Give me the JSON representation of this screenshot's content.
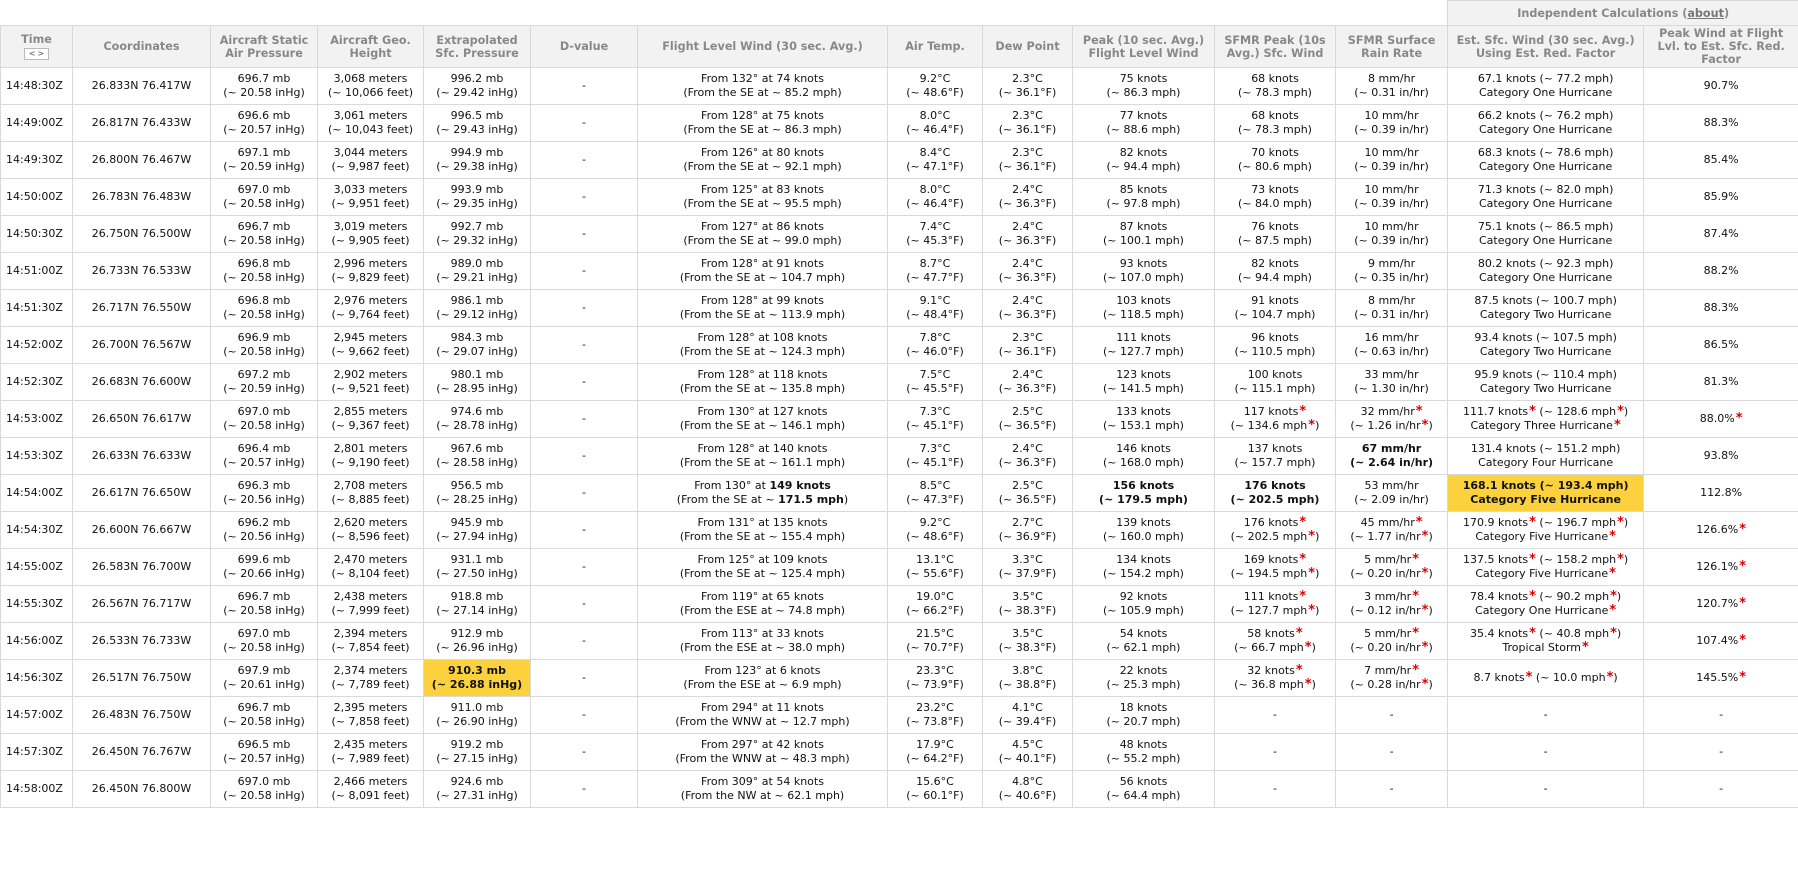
{
  "group_header": {
    "label": "Independent Calculations",
    "link": "about"
  },
  "sort_controls": {
    "prev": "<",
    "next": ">"
  },
  "colors": {
    "highlight": "#fbd23d",
    "flag": "#dd0000",
    "header_bg": "#f2f2f2",
    "header_text": "#888888",
    "border": "#d9d9d9"
  },
  "icons": {
    "flag": "asterisk"
  },
  "columns": [
    "Time",
    "Coordinates",
    "Aircraft Static Air Pressure",
    "Aircraft Geo. Height",
    "Extrapolated Sfc. Pressure",
    "D-value",
    "Flight Level Wind (30 sec. Avg.)",
    "Air Temp.",
    "Dew Point",
    "Peak (10 sec. Avg.) Flight Level Wind",
    "SFMR Peak (10s Avg.) Sfc. Wind",
    "SFMR Surface Rain Rate",
    "Est. Sfc. Wind (30 sec. Avg.) Using Est. Red. Factor",
    "Peak Wind at Flight Lvl. to Est. Sfc. Red. Factor"
  ],
  "rows": [
    {
      "time": "14:48:30Z",
      "coords": "26.833N 76.417W",
      "pressure": [
        "696.7 mb",
        "(~ 20.58 inHg)"
      ],
      "height": [
        "3,068 meters",
        "(~ 10,066 feet)"
      ],
      "sfc_pressure": [
        "996.2 mb",
        "(~ 29.42 inHg)"
      ],
      "dvalue": "-",
      "wind": [
        "From 132° at 74 knots",
        "(From the SE at ~ 85.2 mph)"
      ],
      "air_temp": [
        "9.2°C",
        "(~ 48.6°F)"
      ],
      "dew_point": [
        "2.3°C",
        "(~ 36.1°F)"
      ],
      "peak_fl": [
        "75 knots",
        "(~ 86.3 mph)"
      ],
      "sfmr_wind": [
        "68 knots",
        "(~ 78.3 mph)"
      ],
      "rain": [
        "8 mm/hr",
        "(~ 0.31 in/hr)"
      ],
      "est_wind": [
        "67.1 knots (~ 77.2 mph)",
        "Category One Hurricane"
      ],
      "factor": "90.7%"
    },
    {
      "time": "14:49:00Z",
      "coords": "26.817N 76.433W",
      "pressure": [
        "696.6 mb",
        "(~ 20.57 inHg)"
      ],
      "height": [
        "3,061 meters",
        "(~ 10,043 feet)"
      ],
      "sfc_pressure": [
        "996.5 mb",
        "(~ 29.43 inHg)"
      ],
      "dvalue": "-",
      "wind": [
        "From 128° at 75 knots",
        "(From the SE at ~ 86.3 mph)"
      ],
      "air_temp": [
        "8.0°C",
        "(~ 46.4°F)"
      ],
      "dew_point": [
        "2.3°C",
        "(~ 36.1°F)"
      ],
      "peak_fl": [
        "77 knots",
        "(~ 88.6 mph)"
      ],
      "sfmr_wind": [
        "68 knots",
        "(~ 78.3 mph)"
      ],
      "rain": [
        "10 mm/hr",
        "(~ 0.39 in/hr)"
      ],
      "est_wind": [
        "66.2 knots (~ 76.2 mph)",
        "Category One Hurricane"
      ],
      "factor": "88.3%"
    },
    {
      "time": "14:49:30Z",
      "coords": "26.800N 76.467W",
      "pressure": [
        "697.1 mb",
        "(~ 20.59 inHg)"
      ],
      "height": [
        "3,044 meters",
        "(~ 9,987 feet)"
      ],
      "sfc_pressure": [
        "994.9 mb",
        "(~ 29.38 inHg)"
      ],
      "dvalue": "-",
      "wind": [
        "From 126° at 80 knots",
        "(From the SE at ~ 92.1 mph)"
      ],
      "air_temp": [
        "8.4°C",
        "(~ 47.1°F)"
      ],
      "dew_point": [
        "2.3°C",
        "(~ 36.1°F)"
      ],
      "peak_fl": [
        "82 knots",
        "(~ 94.4 mph)"
      ],
      "sfmr_wind": [
        "70 knots",
        "(~ 80.6 mph)"
      ],
      "rain": [
        "10 mm/hr",
        "(~ 0.39 in/hr)"
      ],
      "est_wind": [
        "68.3 knots (~ 78.6 mph)",
        "Category One Hurricane"
      ],
      "factor": "85.4%"
    },
    {
      "time": "14:50:00Z",
      "coords": "26.783N 76.483W",
      "pressure": [
        "697.0 mb",
        "(~ 20.58 inHg)"
      ],
      "height": [
        "3,033 meters",
        "(~ 9,951 feet)"
      ],
      "sfc_pressure": [
        "993.9 mb",
        "(~ 29.35 inHg)"
      ],
      "dvalue": "-",
      "wind": [
        "From 125° at 83 knots",
        "(From the SE at ~ 95.5 mph)"
      ],
      "air_temp": [
        "8.0°C",
        "(~ 46.4°F)"
      ],
      "dew_point": [
        "2.4°C",
        "(~ 36.3°F)"
      ],
      "peak_fl": [
        "85 knots",
        "(~ 97.8 mph)"
      ],
      "sfmr_wind": [
        "73 knots",
        "(~ 84.0 mph)"
      ],
      "rain": [
        "10 mm/hr",
        "(~ 0.39 in/hr)"
      ],
      "est_wind": [
        "71.3 knots (~ 82.0 mph)",
        "Category One Hurricane"
      ],
      "factor": "85.9%"
    },
    {
      "time": "14:50:30Z",
      "coords": "26.750N 76.500W",
      "pressure": [
        "696.7 mb",
        "(~ 20.58 inHg)"
      ],
      "height": [
        "3,019 meters",
        "(~ 9,905 feet)"
      ],
      "sfc_pressure": [
        "992.7 mb",
        "(~ 29.32 inHg)"
      ],
      "dvalue": "-",
      "wind": [
        "From 127° at 86 knots",
        "(From the SE at ~ 99.0 mph)"
      ],
      "air_temp": [
        "7.4°C",
        "(~ 45.3°F)"
      ],
      "dew_point": [
        "2.4°C",
        "(~ 36.3°F)"
      ],
      "peak_fl": [
        "87 knots",
        "(~ 100.1 mph)"
      ],
      "sfmr_wind": [
        "76 knots",
        "(~ 87.5 mph)"
      ],
      "rain": [
        "10 mm/hr",
        "(~ 0.39 in/hr)"
      ],
      "est_wind": [
        "75.1 knots (~ 86.5 mph)",
        "Category One Hurricane"
      ],
      "factor": "87.4%"
    },
    {
      "time": "14:51:00Z",
      "coords": "26.733N 76.533W",
      "pressure": [
        "696.8 mb",
        "(~ 20.58 inHg)"
      ],
      "height": [
        "2,996 meters",
        "(~ 9,829 feet)"
      ],
      "sfc_pressure": [
        "989.0 mb",
        "(~ 29.21 inHg)"
      ],
      "dvalue": "-",
      "wind": [
        "From 128° at 91 knots",
        "(From the SE at ~ 104.7 mph)"
      ],
      "air_temp": [
        "8.7°C",
        "(~ 47.7°F)"
      ],
      "dew_point": [
        "2.4°C",
        "(~ 36.3°F)"
      ],
      "peak_fl": [
        "93 knots",
        "(~ 107.0 mph)"
      ],
      "sfmr_wind": [
        "82 knots",
        "(~ 94.4 mph)"
      ],
      "rain": [
        "9 mm/hr",
        "(~ 0.35 in/hr)"
      ],
      "est_wind": [
        "80.2 knots (~ 92.3 mph)",
        "Category One Hurricane"
      ],
      "factor": "88.2%"
    },
    {
      "time": "14:51:30Z",
      "coords": "26.717N 76.550W",
      "pressure": [
        "696.8 mb",
        "(~ 20.58 inHg)"
      ],
      "height": [
        "2,976 meters",
        "(~ 9,764 feet)"
      ],
      "sfc_pressure": [
        "986.1 mb",
        "(~ 29.12 inHg)"
      ],
      "dvalue": "-",
      "wind": [
        "From 128° at 99 knots",
        "(From the SE at ~ 113.9 mph)"
      ],
      "air_temp": [
        "9.1°C",
        "(~ 48.4°F)"
      ],
      "dew_point": [
        "2.4°C",
        "(~ 36.3°F)"
      ],
      "peak_fl": [
        "103 knots",
        "(~ 118.5 mph)"
      ],
      "sfmr_wind": [
        "91 knots",
        "(~ 104.7 mph)"
      ],
      "rain": [
        "8 mm/hr",
        "(~ 0.31 in/hr)"
      ],
      "est_wind": [
        "87.5 knots (~ 100.7 mph)",
        "Category Two Hurricane"
      ],
      "factor": "88.3%"
    },
    {
      "time": "14:52:00Z",
      "coords": "26.700N 76.567W",
      "pressure": [
        "696.9 mb",
        "(~ 20.58 inHg)"
      ],
      "height": [
        "2,945 meters",
        "(~ 9,662 feet)"
      ],
      "sfc_pressure": [
        "984.3 mb",
        "(~ 29.07 inHg)"
      ],
      "dvalue": "-",
      "wind": [
        "From 128° at 108 knots",
        "(From the SE at ~ 124.3 mph)"
      ],
      "air_temp": [
        "7.8°C",
        "(~ 46.0°F)"
      ],
      "dew_point": [
        "2.3°C",
        "(~ 36.1°F)"
      ],
      "peak_fl": [
        "111 knots",
        "(~ 127.7 mph)"
      ],
      "sfmr_wind": [
        "96 knots",
        "(~ 110.5 mph)"
      ],
      "rain": [
        "16 mm/hr",
        "(~ 0.63 in/hr)"
      ],
      "est_wind": [
        "93.4 knots (~ 107.5 mph)",
        "Category Two Hurricane"
      ],
      "factor": "86.5%"
    },
    {
      "time": "14:52:30Z",
      "coords": "26.683N 76.600W",
      "pressure": [
        "697.2 mb",
        "(~ 20.59 inHg)"
      ],
      "height": [
        "2,902 meters",
        "(~ 9,521 feet)"
      ],
      "sfc_pressure": [
        "980.1 mb",
        "(~ 28.95 inHg)"
      ],
      "dvalue": "-",
      "wind": [
        "From 128° at 118 knots",
        "(From the SE at ~ 135.8 mph)"
      ],
      "air_temp": [
        "7.5°C",
        "(~ 45.5°F)"
      ],
      "dew_point": [
        "2.4°C",
        "(~ 36.3°F)"
      ],
      "peak_fl": [
        "123 knots",
        "(~ 141.5 mph)"
      ],
      "sfmr_wind": [
        "100 knots",
        "(~ 115.1 mph)"
      ],
      "rain": [
        "33 mm/hr",
        "(~ 1.30 in/hr)"
      ],
      "est_wind": [
        "95.9 knots (~ 110.4 mph)",
        "Category Two Hurricane"
      ],
      "factor": "81.3%"
    },
    {
      "time": "14:53:00Z",
      "coords": "26.650N 76.617W",
      "pressure": [
        "697.0 mb",
        "(~ 20.58 inHg)"
      ],
      "height": [
        "2,855 meters",
        "(~ 9,367 feet)"
      ],
      "sfc_pressure": [
        "974.6 mb",
        "(~ 28.78 inHg)"
      ],
      "dvalue": "-",
      "wind": [
        "From 130° at 127 knots",
        "(From the SE at ~ 146.1 mph)"
      ],
      "air_temp": [
        "7.3°C",
        "(~ 45.1°F)"
      ],
      "dew_point": [
        "2.5°C",
        "(~ 36.5°F)"
      ],
      "peak_fl": [
        "133 knots",
        "(~ 153.1 mph)"
      ],
      "sfmr_wind": [
        "117 knots*",
        "(~ 134.6 mph*)"
      ],
      "rain": [
        "32 mm/hr*",
        "(~ 1.26 in/hr*)"
      ],
      "est_wind": [
        "111.7 knots* (~ 128.6 mph*)",
        "Category Three Hurricane*"
      ],
      "factor": "88.0%*"
    },
    {
      "time": "14:53:30Z",
      "coords": "26.633N 76.633W",
      "pressure": [
        "696.4 mb",
        "(~ 20.57 inHg)"
      ],
      "height": [
        "2,801 meters",
        "(~ 9,190 feet)"
      ],
      "sfc_pressure": [
        "967.6 mb",
        "(~ 28.58 inHg)"
      ],
      "dvalue": "-",
      "wind": [
        "From 128° at 140 knots",
        "(From the SE at ~ 161.1 mph)"
      ],
      "air_temp": [
        "7.3°C",
        "(~ 45.1°F)"
      ],
      "dew_point": [
        "2.4°C",
        "(~ 36.3°F)"
      ],
      "peak_fl": [
        "146 knots",
        "(~ 168.0 mph)"
      ],
      "sfmr_wind": [
        "137 knots",
        "(~ 157.7 mph)"
      ],
      "rain": [
        "**67 mm/hr**",
        "**(~ 2.64 in/hr)**"
      ],
      "est_wind": [
        "131.4 knots (~ 151.2 mph)",
        "Category Four Hurricane"
      ],
      "factor": "93.8%"
    },
    {
      "time": "14:54:00Z",
      "coords": "26.617N 76.650W",
      "pressure": [
        "696.3 mb",
        "(~ 20.56 inHg)"
      ],
      "height": [
        "2,708 meters",
        "(~ 8,885 feet)"
      ],
      "sfc_pressure": [
        "956.5 mb",
        "(~ 28.25 inHg)"
      ],
      "dvalue": "-",
      "wind": [
        "From 130° at **149 knots**",
        "(From the SE at ~ **171.5 mph**)"
      ],
      "air_temp": [
        "8.5°C",
        "(~ 47.3°F)"
      ],
      "dew_point": [
        "2.5°C",
        "(~ 36.5°F)"
      ],
      "peak_fl": [
        "**156 knots**",
        "**(~ 179.5 mph)**"
      ],
      "sfmr_wind": [
        "**176 knots**",
        "**(~ 202.5 mph)**"
      ],
      "rain": [
        "53 mm/hr",
        "(~ 2.09 in/hr)"
      ],
      "est_wind": [
        "**168.1 knots (~ 193.4 mph)**",
        "**Category Five Hurricane**"
      ],
      "factor": "112.8%",
      "highlight": "est_wind"
    },
    {
      "time": "14:54:30Z",
      "coords": "26.600N 76.667W",
      "pressure": [
        "696.2 mb",
        "(~ 20.56 inHg)"
      ],
      "height": [
        "2,620 meters",
        "(~ 8,596 feet)"
      ],
      "sfc_pressure": [
        "945.9 mb",
        "(~ 27.94 inHg)"
      ],
      "dvalue": "-",
      "wind": [
        "From 131° at 135 knots",
        "(From the SE at ~ 155.4 mph)"
      ],
      "air_temp": [
        "9.2°C",
        "(~ 48.6°F)"
      ],
      "dew_point": [
        "2.7°C",
        "(~ 36.9°F)"
      ],
      "peak_fl": [
        "139 knots",
        "(~ 160.0 mph)"
      ],
      "sfmr_wind": [
        "176 knots*",
        "(~ 202.5 mph*)"
      ],
      "rain": [
        "45 mm/hr*",
        "(~ 1.77 in/hr*)"
      ],
      "est_wind": [
        "170.9 knots* (~ 196.7 mph*)",
        "Category Five Hurricane*"
      ],
      "factor": "126.6%*"
    },
    {
      "time": "14:55:00Z",
      "coords": "26.583N 76.700W",
      "pressure": [
        "699.6 mb",
        "(~ 20.66 inHg)"
      ],
      "height": [
        "2,470 meters",
        "(~ 8,104 feet)"
      ],
      "sfc_pressure": [
        "931.1 mb",
        "(~ 27.50 inHg)"
      ],
      "dvalue": "-",
      "wind": [
        "From 125° at 109 knots",
        "(From the SE at ~ 125.4 mph)"
      ],
      "air_temp": [
        "13.1°C",
        "(~ 55.6°F)"
      ],
      "dew_point": [
        "3.3°C",
        "(~ 37.9°F)"
      ],
      "peak_fl": [
        "134 knots",
        "(~ 154.2 mph)"
      ],
      "sfmr_wind": [
        "169 knots*",
        "(~ 194.5 mph*)"
      ],
      "rain": [
        "5 mm/hr*",
        "(~ 0.20 in/hr*)"
      ],
      "est_wind": [
        "137.5 knots* (~ 158.2 mph*)",
        "Category Five Hurricane*"
      ],
      "factor": "126.1%*"
    },
    {
      "time": "14:55:30Z",
      "coords": "26.567N 76.717W",
      "pressure": [
        "696.7 mb",
        "(~ 20.58 inHg)"
      ],
      "height": [
        "2,438 meters",
        "(~ 7,999 feet)"
      ],
      "sfc_pressure": [
        "918.8 mb",
        "(~ 27.14 inHg)"
      ],
      "dvalue": "-",
      "wind": [
        "From 119° at 65 knots",
        "(From the ESE at ~ 74.8 mph)"
      ],
      "air_temp": [
        "19.0°C",
        "(~ 66.2°F)"
      ],
      "dew_point": [
        "3.5°C",
        "(~ 38.3°F)"
      ],
      "peak_fl": [
        "92 knots",
        "(~ 105.9 mph)"
      ],
      "sfmr_wind": [
        "111 knots*",
        "(~ 127.7 mph*)"
      ],
      "rain": [
        "3 mm/hr*",
        "(~ 0.12 in/hr*)"
      ],
      "est_wind": [
        "78.4 knots* (~ 90.2 mph*)",
        "Category One Hurricane*"
      ],
      "factor": "120.7%*"
    },
    {
      "time": "14:56:00Z",
      "coords": "26.533N 76.733W",
      "pressure": [
        "697.0 mb",
        "(~ 20.58 inHg)"
      ],
      "height": [
        "2,394 meters",
        "(~ 7,854 feet)"
      ],
      "sfc_pressure": [
        "912.9 mb",
        "(~ 26.96 inHg)"
      ],
      "dvalue": "-",
      "wind": [
        "From 113° at 33 knots",
        "(From the ESE at ~ 38.0 mph)"
      ],
      "air_temp": [
        "21.5°C",
        "(~ 70.7°F)"
      ],
      "dew_point": [
        "3.5°C",
        "(~ 38.3°F)"
      ],
      "peak_fl": [
        "54 knots",
        "(~ 62.1 mph)"
      ],
      "sfmr_wind": [
        "58 knots*",
        "(~ 66.7 mph*)"
      ],
      "rain": [
        "5 mm/hr*",
        "(~ 0.20 in/hr*)"
      ],
      "est_wind": [
        "35.4 knots* (~ 40.8 mph*)",
        "Tropical Storm*"
      ],
      "factor": "107.4%*"
    },
    {
      "time": "14:56:30Z",
      "coords": "26.517N 76.750W",
      "pressure": [
        "697.9 mb",
        "(~ 20.61 inHg)"
      ],
      "height": [
        "2,374 meters",
        "(~ 7,789 feet)"
      ],
      "sfc_pressure": [
        "**910.3 mb**",
        "**(~ 26.88 inHg)**"
      ],
      "dvalue": "-",
      "wind": [
        "From 123° at 6 knots",
        "(From the ESE at ~ 6.9 mph)"
      ],
      "air_temp": [
        "23.3°C",
        "(~ 73.9°F)"
      ],
      "dew_point": [
        "3.8°C",
        "(~ 38.8°F)"
      ],
      "peak_fl": [
        "22 knots",
        "(~ 25.3 mph)"
      ],
      "sfmr_wind": [
        "32 knots*",
        "(~ 36.8 mph*)"
      ],
      "rain": [
        "7 mm/hr*",
        "(~ 0.28 in/hr*)"
      ],
      "est_wind": [
        "8.7 knots* (~ 10.0 mph*)"
      ],
      "factor": "145.5%*",
      "highlight": "sfc_pressure"
    },
    {
      "time": "14:57:00Z",
      "coords": "26.483N 76.750W",
      "pressure": [
        "696.7 mb",
        "(~ 20.58 inHg)"
      ],
      "height": [
        "2,395 meters",
        "(~ 7,858 feet)"
      ],
      "sfc_pressure": [
        "911.0 mb",
        "(~ 26.90 inHg)"
      ],
      "dvalue": "-",
      "wind": [
        "From 294° at 11 knots",
        "(From the WNW at ~ 12.7 mph)"
      ],
      "air_temp": [
        "23.2°C",
        "(~ 73.8°F)"
      ],
      "dew_point": [
        "4.1°C",
        "(~ 39.4°F)"
      ],
      "peak_fl": [
        "18 knots",
        "(~ 20.7 mph)"
      ],
      "sfmr_wind": [
        "-"
      ],
      "rain": [
        "-"
      ],
      "est_wind": [
        "-"
      ],
      "factor": "-"
    },
    {
      "time": "14:57:30Z",
      "coords": "26.450N 76.767W",
      "pressure": [
        "696.5 mb",
        "(~ 20.57 inHg)"
      ],
      "height": [
        "2,435 meters",
        "(~ 7,989 feet)"
      ],
      "sfc_pressure": [
        "919.2 mb",
        "(~ 27.15 inHg)"
      ],
      "dvalue": "-",
      "wind": [
        "From 297° at 42 knots",
        "(From the WNW at ~ 48.3 mph)"
      ],
      "air_temp": [
        "17.9°C",
        "(~ 64.2°F)"
      ],
      "dew_point": [
        "4.5°C",
        "(~ 40.1°F)"
      ],
      "peak_fl": [
        "48 knots",
        "(~ 55.2 mph)"
      ],
      "sfmr_wind": [
        "-"
      ],
      "rain": [
        "-"
      ],
      "est_wind": [
        "-"
      ],
      "factor": "-"
    },
    {
      "time": "14:58:00Z",
      "coords": "26.450N 76.800W",
      "pressure": [
        "697.0 mb",
        "(~ 20.58 inHg)"
      ],
      "height": [
        "2,466 meters",
        "(~ 8,091 feet)"
      ],
      "sfc_pressure": [
        "924.6 mb",
        "(~ 27.31 inHg)"
      ],
      "dvalue": "-",
      "wind": [
        "From 309° at 54 knots",
        "(From the NW at ~ 62.1 mph)"
      ],
      "air_temp": [
        "15.6°C",
        "(~ 60.1°F)"
      ],
      "dew_point": [
        "4.8°C",
        "(~ 40.6°F)"
      ],
      "peak_fl": [
        "56 knots",
        "(~ 64.4 mph)"
      ],
      "sfmr_wind": [
        "-"
      ],
      "rain": [
        "-"
      ],
      "est_wind": [
        "-"
      ],
      "factor": "-"
    }
  ]
}
